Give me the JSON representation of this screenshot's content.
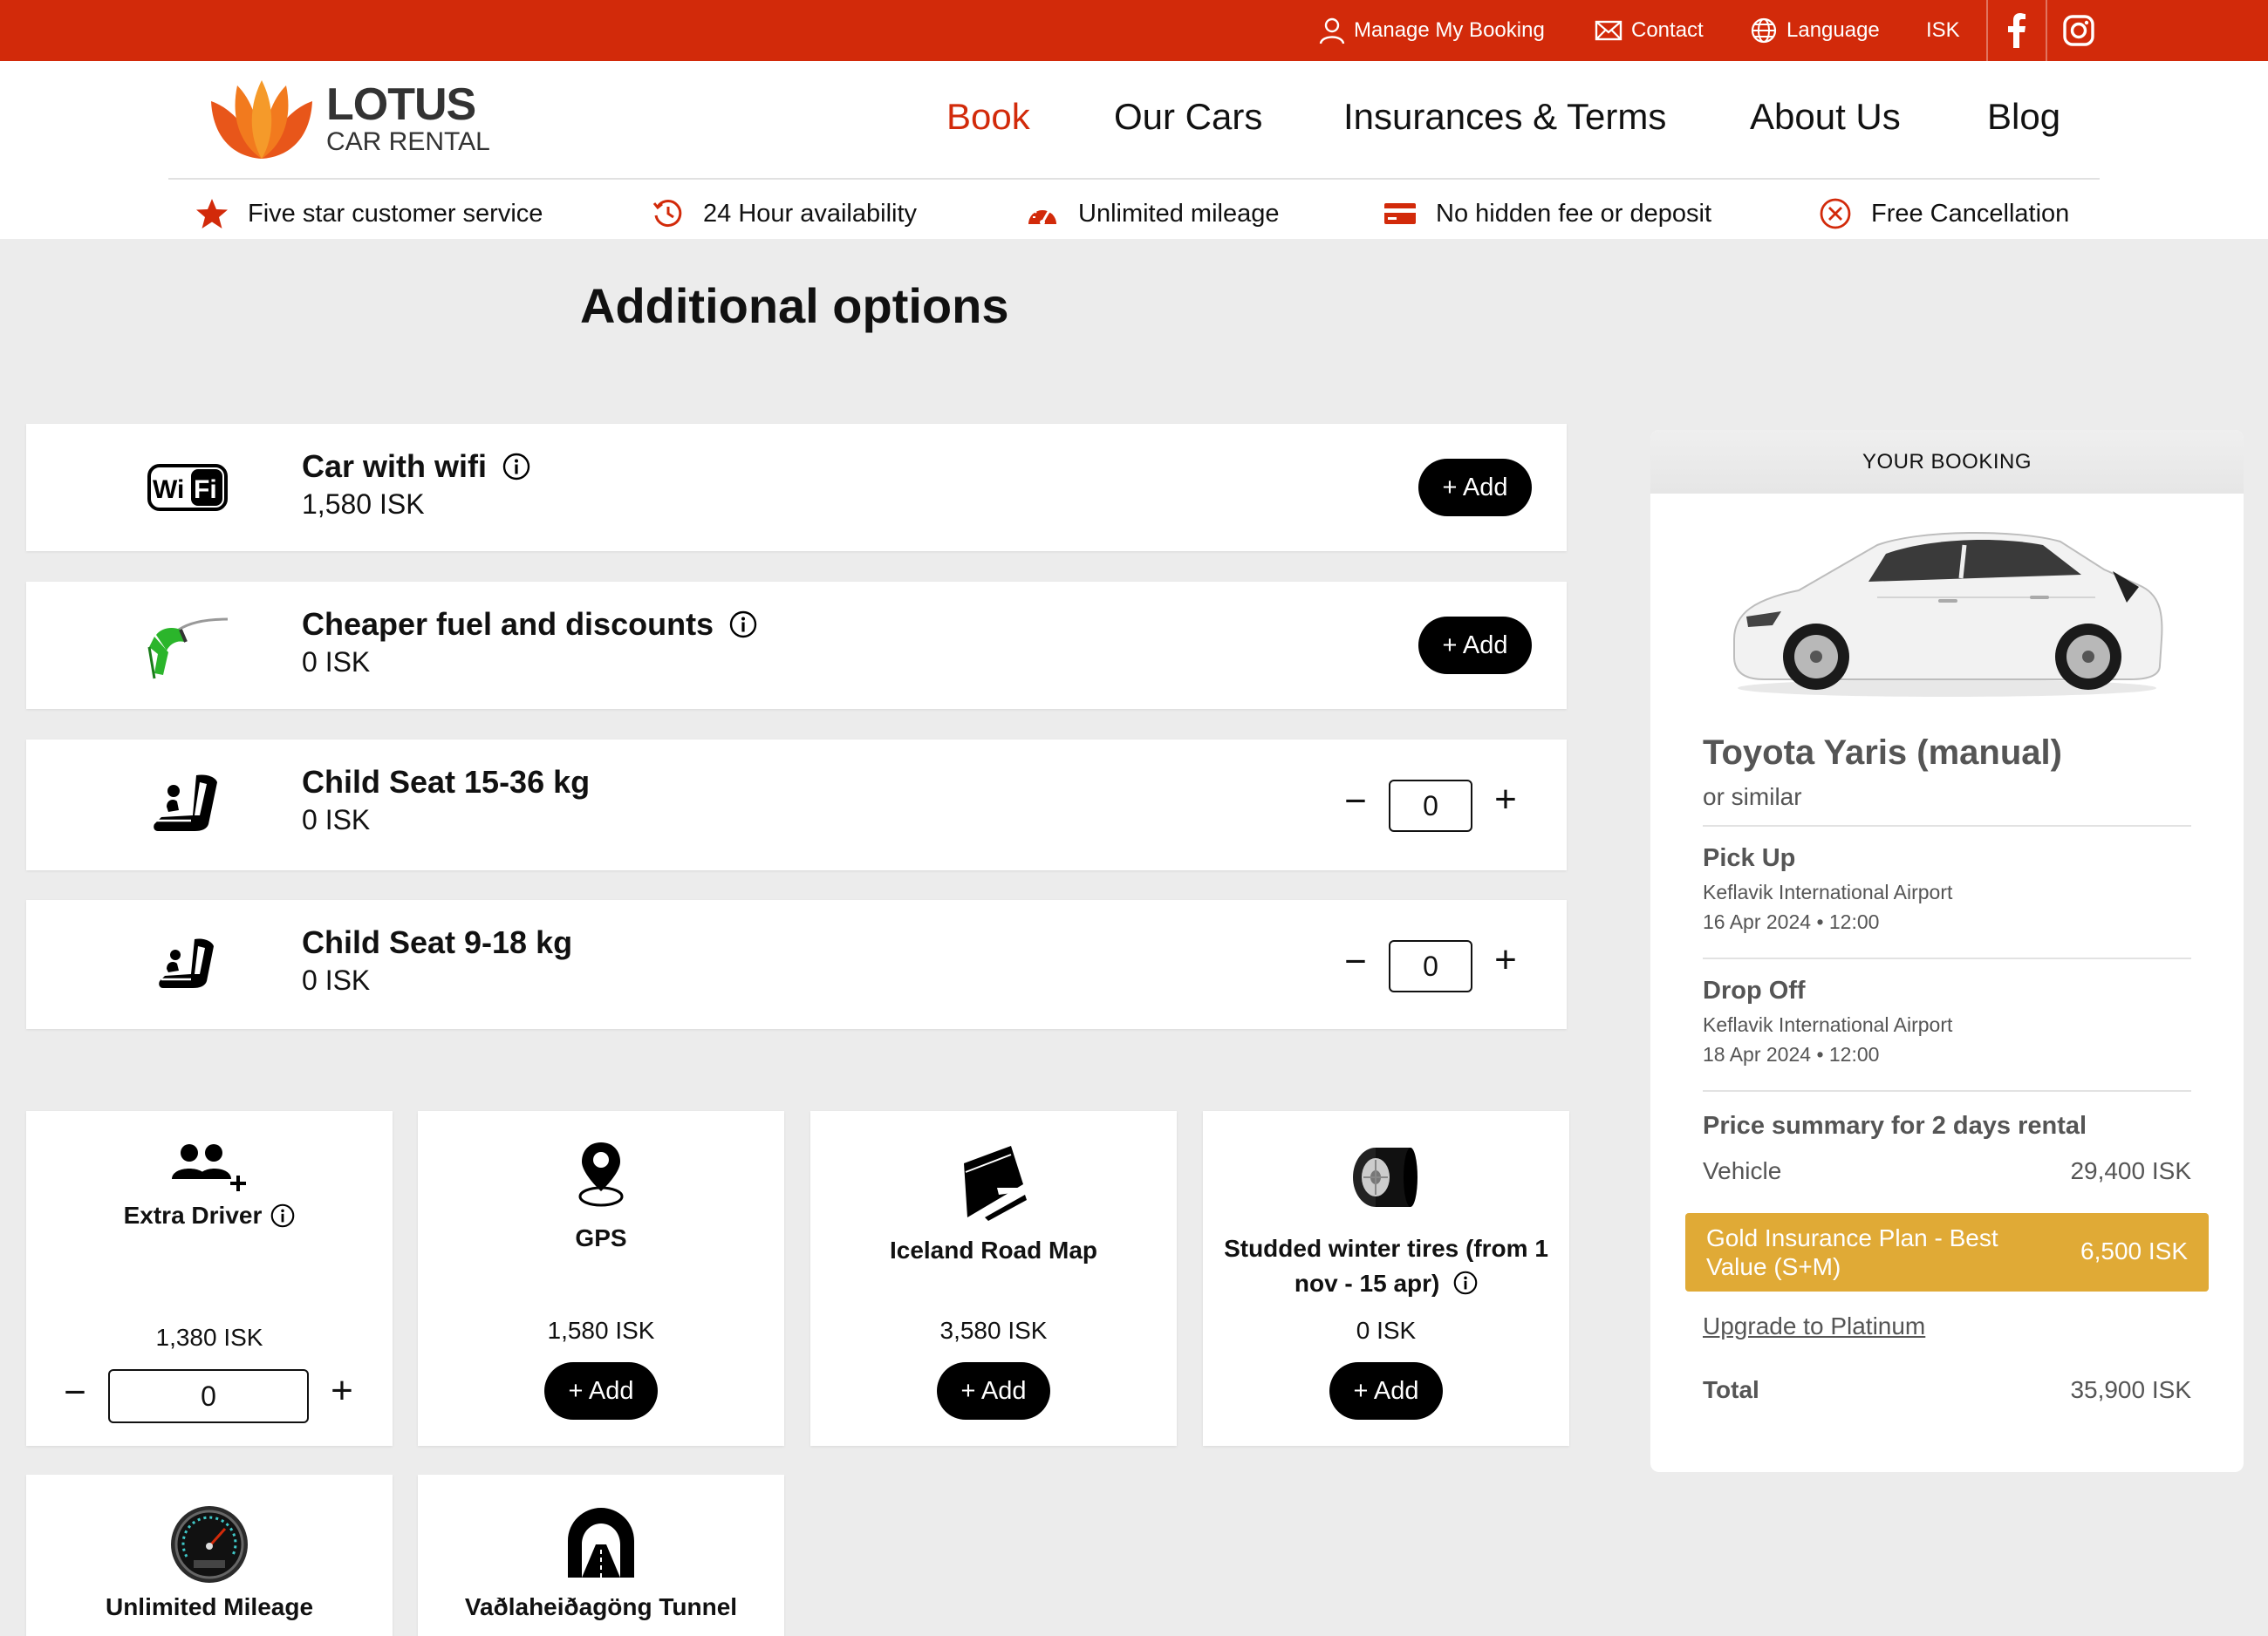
{
  "topbar": {
    "manage_booking": "Manage My Booking",
    "contact": "Contact",
    "language": "Language",
    "currency": "ISK",
    "colors": {
      "background": "#d22a0a"
    }
  },
  "header": {
    "logo_title": "LOTUS",
    "logo_subtitle": "CAR RENTAL",
    "nav": [
      "Book",
      "Our Cars",
      "Insurances & Terms",
      "About Us",
      "Blog"
    ],
    "features": [
      "Five star customer service",
      "24 Hour availability",
      "Unlimited mileage",
      "No hidden fee or deposit",
      "Free Cancellation"
    ]
  },
  "main": {
    "title": "Additional options",
    "rows": [
      {
        "name": "Car with wifi",
        "price": "1,580 ISK",
        "icon": "wifi-icon",
        "action": "+ Add"
      },
      {
        "name": "Cheaper fuel and discounts",
        "price": "0 ISK",
        "icon": "fuel-nozzle-icon",
        "action": "+ Add"
      },
      {
        "name": "Child Seat 15-36 kg",
        "price": "0 ISK",
        "icon": "booster-seat-icon",
        "qty": "0"
      },
      {
        "name": "Child Seat 9-18 kg",
        "price": "0 ISK",
        "icon": "child-seat-icon",
        "qty": "0"
      }
    ],
    "cards": [
      {
        "name": "Extra Driver",
        "price": "1,380 ISK",
        "icon": "add-user-icon",
        "qty": "0"
      },
      {
        "name": "GPS",
        "price": "1,580 ISK",
        "icon": "map-pin-icon",
        "action": "+ Add"
      },
      {
        "name": "Iceland Road Map",
        "price": "3,580 ISK",
        "icon": "road-map-icon",
        "action": "+ Add"
      },
      {
        "name": "Studded winter tires (from 1 nov - 15 apr)",
        "price": "0 ISK",
        "icon": "tire-icon",
        "action": "+ Add"
      },
      {
        "name": "Unlimited Mileage",
        "icon": "speedometer-icon"
      },
      {
        "name": "Vaðlaheiðagöng Tunnel",
        "icon": "tunnel-icon"
      }
    ],
    "stepper": {
      "minus": "−",
      "plus": "+"
    }
  },
  "booking": {
    "header": "YOUR BOOKING",
    "car_model": "Toyota Yaris (manual)",
    "similar": "or similar",
    "pickup": {
      "label": "Pick Up",
      "location": "Keflavik International Airport",
      "datetime": "16 Apr 2024 • 12:00"
    },
    "dropoff": {
      "label": "Drop Off",
      "location": "Keflavik International Airport",
      "datetime": "18 Apr 2024 • 12:00"
    },
    "price_summary_title": "Price summary for 2 days rental",
    "vehicle_label": "Vehicle",
    "vehicle_price": "29,400 ISK",
    "insurance_name": "Gold Insurance Plan - Best Value (S+M)",
    "insurance_price": "6,500 ISK",
    "upgrade_link": "Upgrade to Platinum",
    "total_label": "Total",
    "total_price": "35,900 ISK",
    "colors": {
      "insurance_highlight": "#e0aa36"
    }
  }
}
